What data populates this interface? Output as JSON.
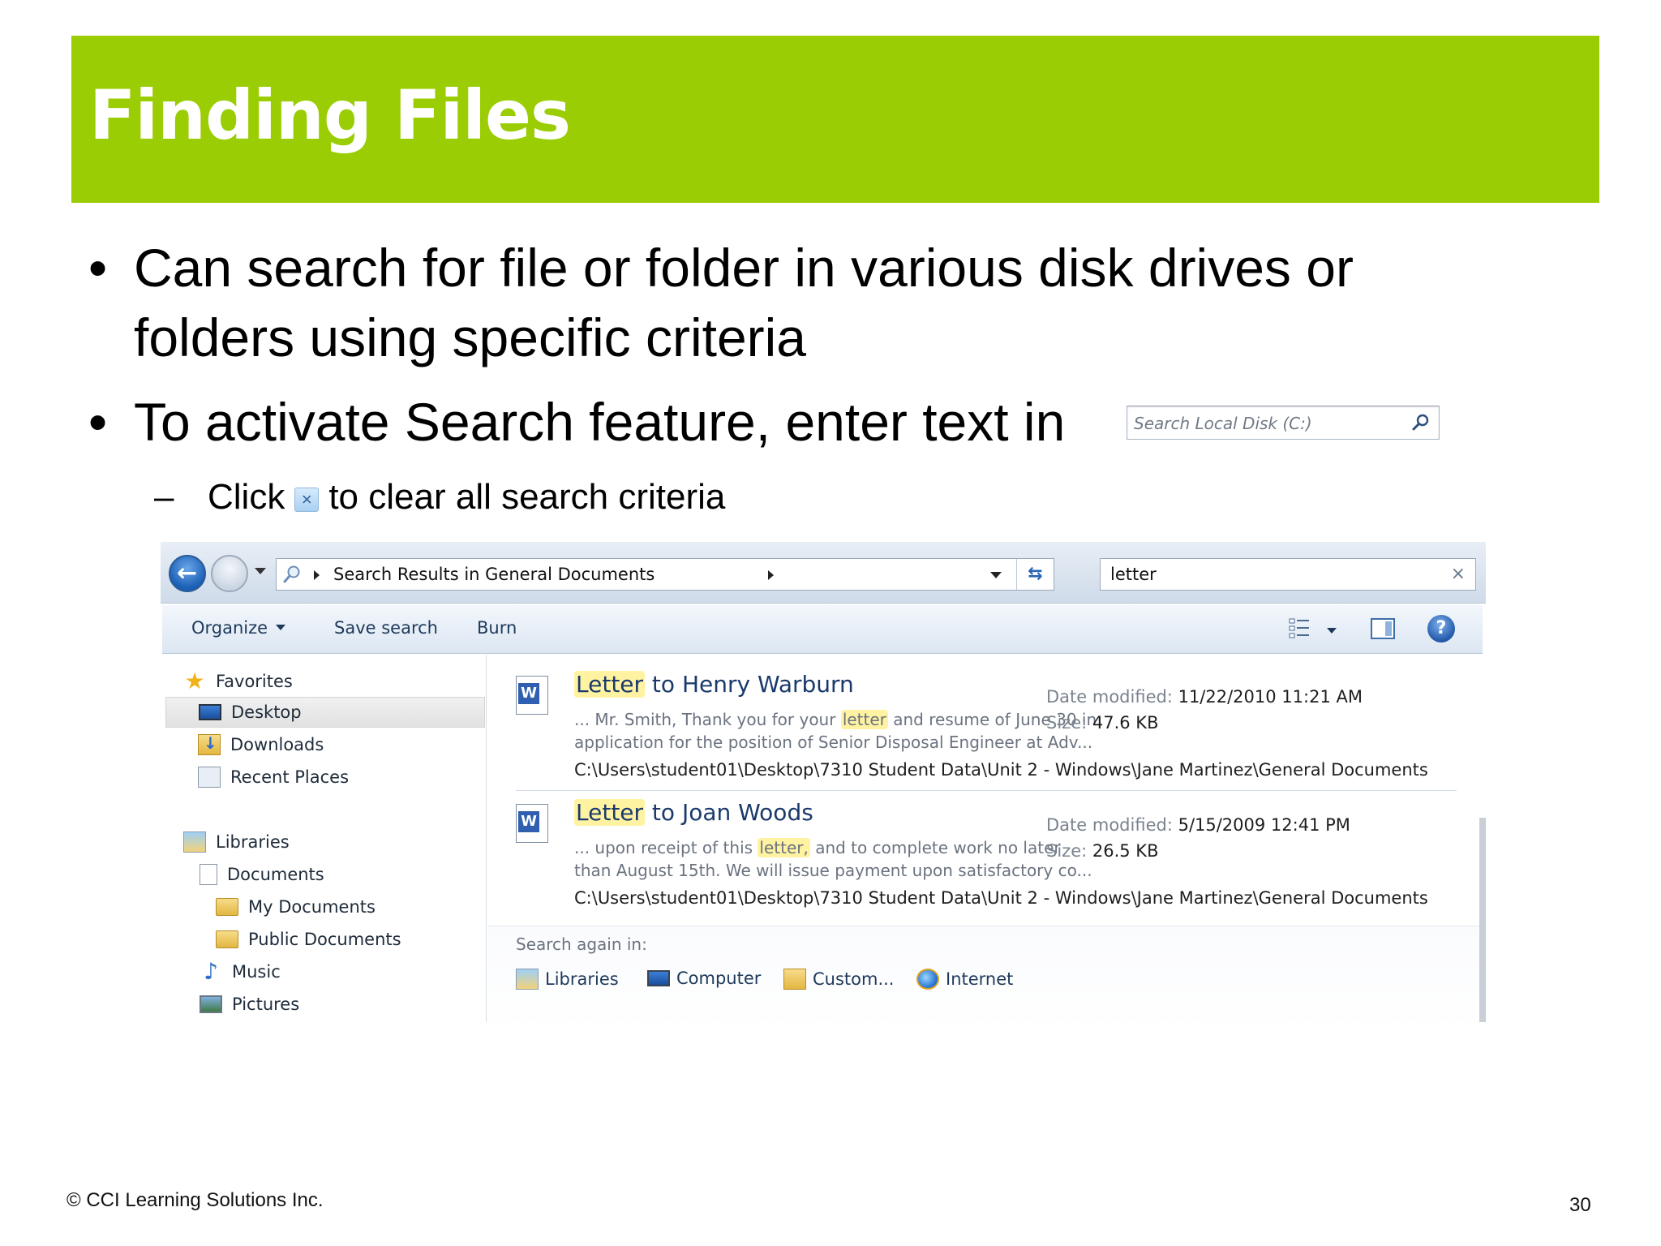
{
  "slide": {
    "title": "Finding Files",
    "bullets": [
      "Can search for file or folder in various disk drives or folders using specific criteria",
      "To activate Search feature, enter text in"
    ],
    "sub_bullet": {
      "dash": "–",
      "before": "Click",
      "after": "to clear all search criteria"
    },
    "search_sample_placeholder": "Search Local Disk (C:)",
    "footer": {
      "copyright": "© CCI Learning Solutions Inc.",
      "page_number": "30"
    }
  },
  "explorer": {
    "address": "Search Results in General Documents",
    "search_value": "letter",
    "toolbar": {
      "organize": "Organize",
      "save_search": "Save search",
      "burn": "Burn"
    },
    "nav": {
      "favorites": "Favorites",
      "desktop": "Desktop",
      "downloads": "Downloads",
      "recent": "Recent Places",
      "libraries": "Libraries",
      "documents": "Documents",
      "my_documents": "My Documents",
      "public_documents": "Public Documents",
      "music": "Music",
      "pictures": "Pictures"
    },
    "results": [
      {
        "title_hl": "Letter",
        "title_rest": " to Henry Warburn",
        "snippet1_a": "... Mr. Smith, Thank you for your ",
        "snippet1_hl": "letter",
        "snippet1_b": " and resume of June 30 in",
        "snippet2": "application for the position of Senior Disposal Engineer at Adv...",
        "path": "C:\\Users\\student01\\Desktop\\7310 Student Data\\Unit 2 - Windows\\Jane Martinez\\General Documents",
        "date_label": "Date modified:",
        "date_value": "11/22/2010 11:21 AM",
        "size_label": "Size:",
        "size_value": "47.6 KB"
      },
      {
        "title_hl": "Letter",
        "title_rest": " to Joan Woods",
        "snippet1_a": "... upon receipt of this ",
        "snippet1_hl": "letter,",
        "snippet1_b": " and to complete work no later",
        "snippet2": "than August 15th. We will issue payment upon satisfactory co...",
        "path": "C:\\Users\\student01\\Desktop\\7310 Student Data\\Unit 2 - Windows\\Jane Martinez\\General Documents",
        "date_label": "Date modified:",
        "date_value": "5/15/2009 12:41 PM",
        "size_label": "Size:",
        "size_value": "26.5 KB"
      }
    ],
    "search_again": {
      "label": "Search again in:",
      "locations": [
        "Libraries",
        "Computer",
        "Custom...",
        "Internet"
      ]
    },
    "colors": {
      "header_green": "#9acd03",
      "highlight": "#fff3a2"
    }
  }
}
